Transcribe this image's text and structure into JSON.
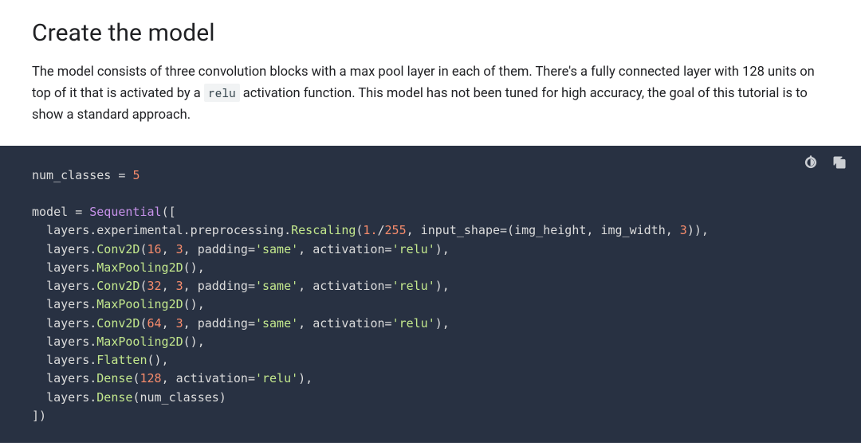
{
  "section": {
    "title": "Create the model",
    "para_parts": {
      "before": "The model consists of three convolution blocks with a max pool layer in each of them. There's a fully connected layer with 128 units on top of it that is activated by a ",
      "inline_code": "relu",
      "after": " activation function. This model has not been tuned for high accuracy, the goal of this tutorial is to show a standard approach."
    }
  },
  "code": {
    "l1": {
      "a": "num_classes ",
      "b": "=",
      "c": " ",
      "d": "5"
    },
    "l3": {
      "a": "model ",
      "b": "=",
      "c": " ",
      "d": "Sequential",
      "e": "(["
    },
    "l4": {
      "pad": "  ",
      "a": "layers.experimental.preprocessing.",
      "cls": "Rescaling",
      "b": "(",
      "n1": "1.",
      "c": "/",
      "n2": "255",
      "d": ", input_shape",
      "e": "=",
      "f": "(img_height, img_width, ",
      "n3": "3",
      "g": ")),"
    },
    "l5": {
      "pad": "  ",
      "a": "layers.",
      "cls": "Conv2D",
      "b": "(",
      "n1": "16",
      "c": ", ",
      "n2": "3",
      "d": ", padding",
      "e": "=",
      "s1": "'same'",
      "f": ", activation",
      "g": "=",
      "s2": "'relu'",
      "h": "),"
    },
    "l6": {
      "pad": "  ",
      "a": "layers.",
      "cls": "MaxPooling2D",
      "b": "(),"
    },
    "l7": {
      "pad": "  ",
      "a": "layers.",
      "cls": "Conv2D",
      "b": "(",
      "n1": "32",
      "c": ", ",
      "n2": "3",
      "d": ", padding",
      "e": "=",
      "s1": "'same'",
      "f": ", activation",
      "g": "=",
      "s2": "'relu'",
      "h": "),"
    },
    "l8": {
      "pad": "  ",
      "a": "layers.",
      "cls": "MaxPooling2D",
      "b": "(),"
    },
    "l9": {
      "pad": "  ",
      "a": "layers.",
      "cls": "Conv2D",
      "b": "(",
      "n1": "64",
      "c": ", ",
      "n2": "3",
      "d": ", padding",
      "e": "=",
      "s1": "'same'",
      "f": ", activation",
      "g": "=",
      "s2": "'relu'",
      "h": "),"
    },
    "l10": {
      "pad": "  ",
      "a": "layers.",
      "cls": "MaxPooling2D",
      "b": "(),"
    },
    "l11": {
      "pad": "  ",
      "a": "layers.",
      "cls": "Flatten",
      "b": "(),"
    },
    "l12": {
      "pad": "  ",
      "a": "layers.",
      "cls": "Dense",
      "b": "(",
      "n1": "128",
      "c": ", activation",
      "d": "=",
      "s1": "'relu'",
      "e": "),"
    },
    "l13": {
      "pad": "  ",
      "a": "layers.",
      "cls": "Dense",
      "b": "(num_classes)"
    },
    "l14": {
      "a": "])"
    }
  }
}
